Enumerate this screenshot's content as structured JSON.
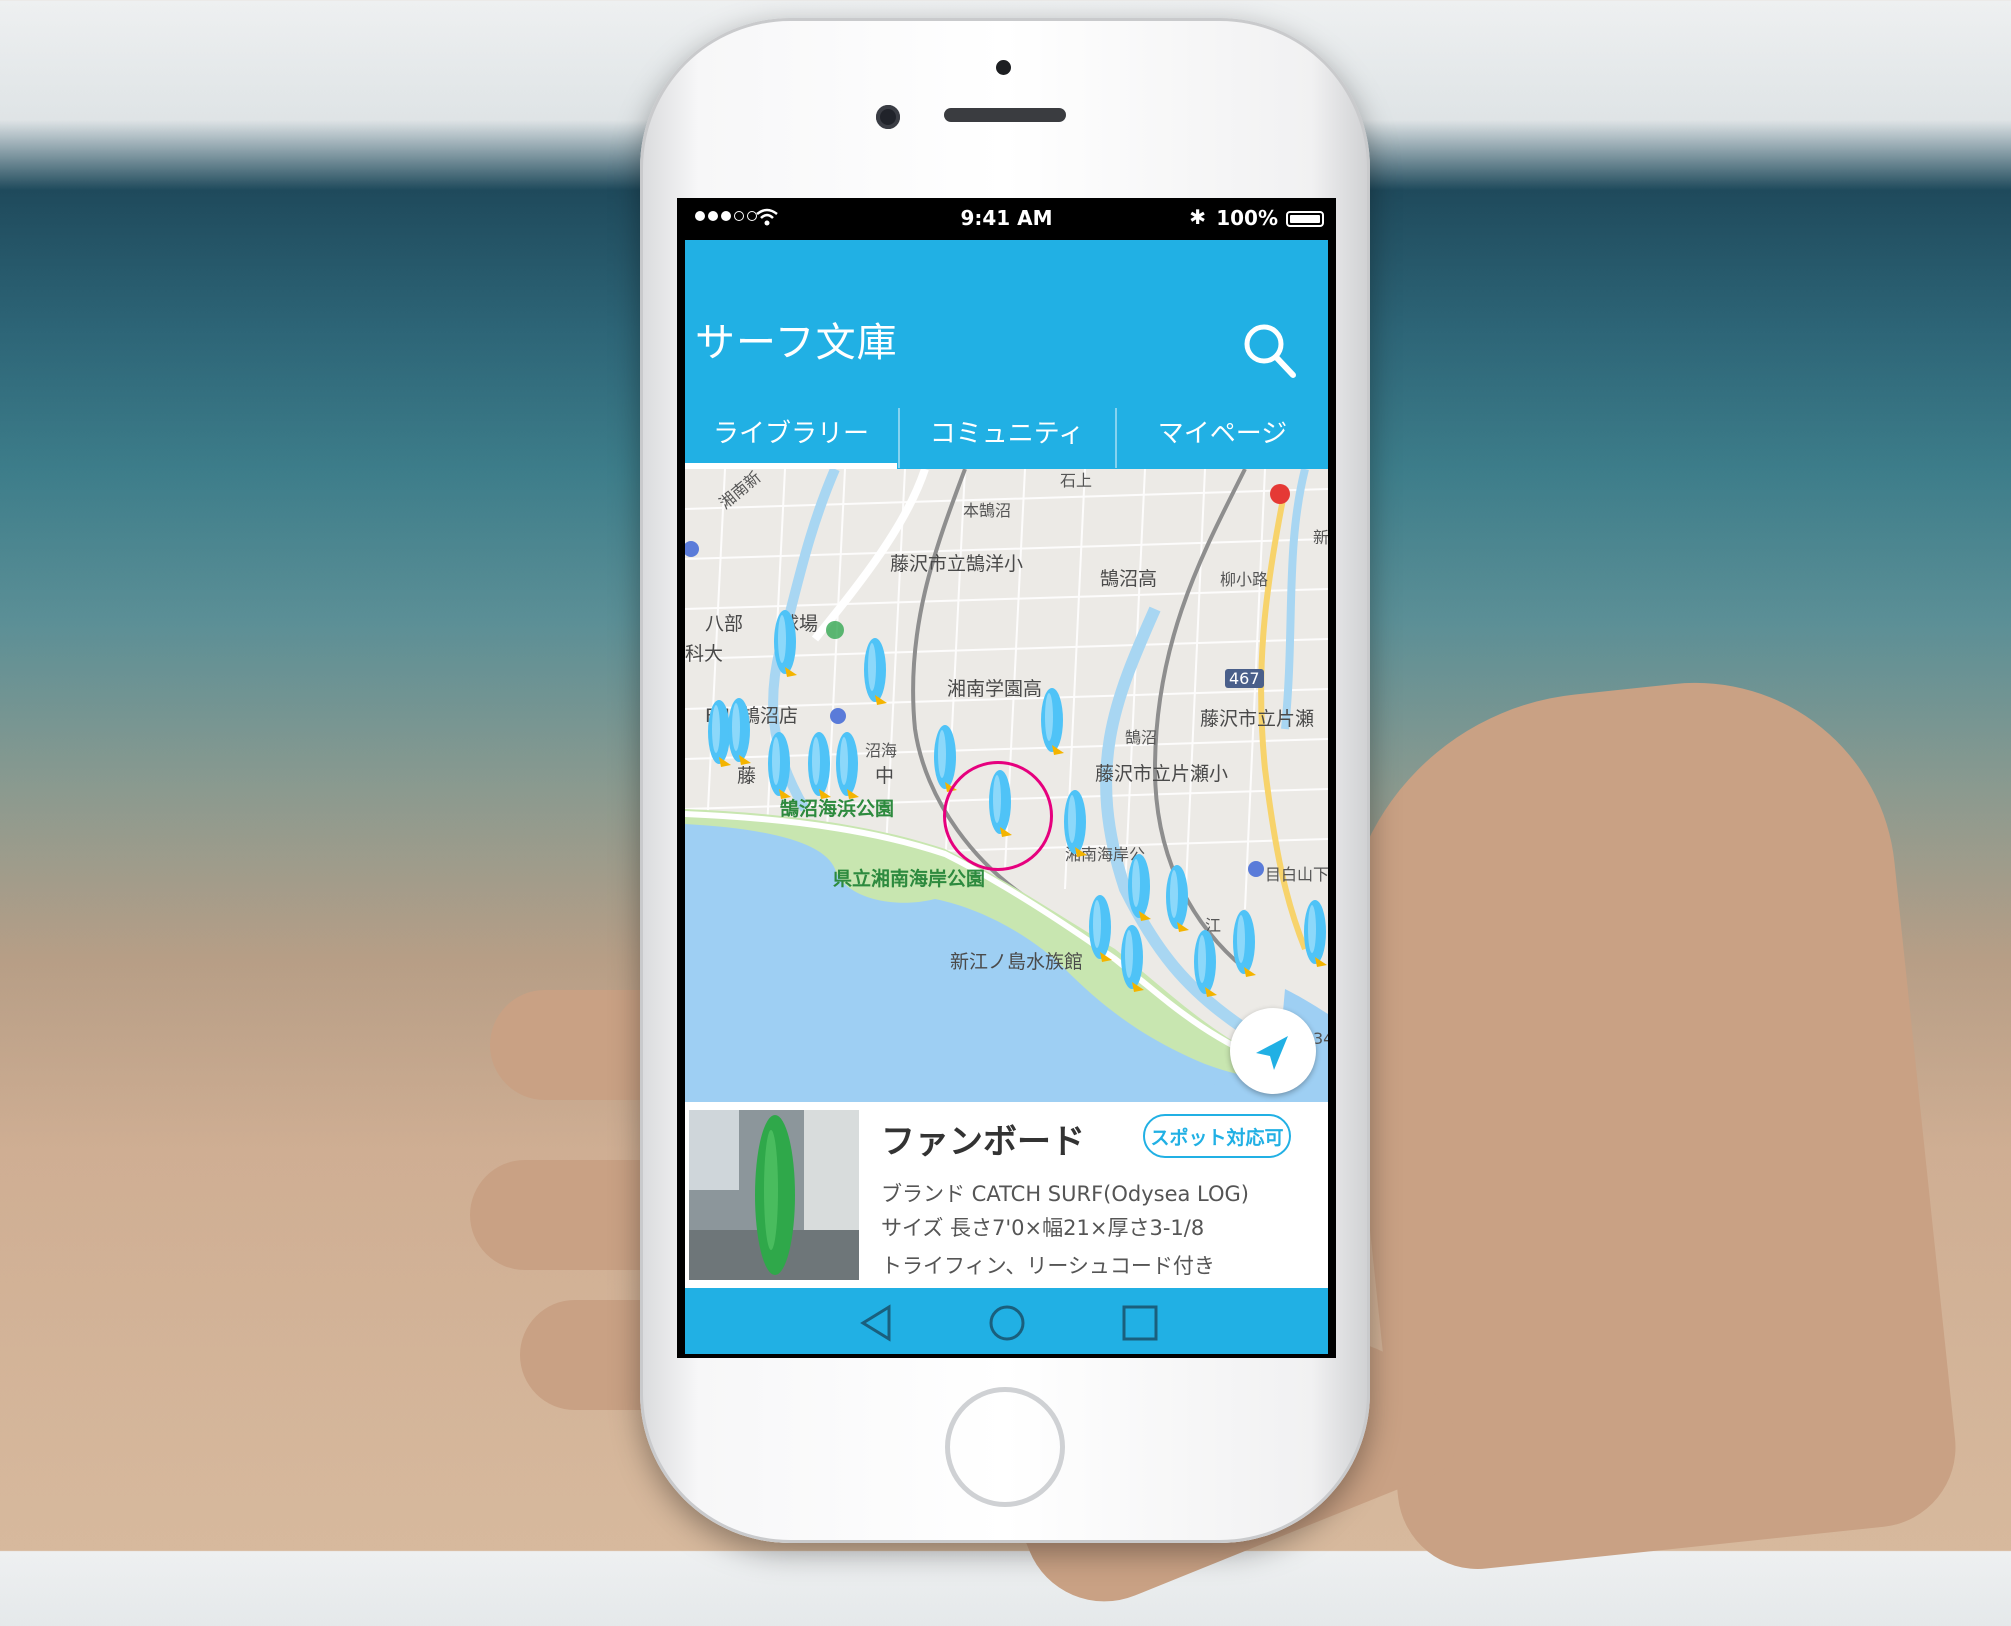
{
  "status_bar": {
    "time": "9:41 AM",
    "battery": "100%",
    "signal_icon": "signal-dots-icon",
    "wifi_icon": "wifi-icon",
    "bluetooth_icon": "bluetooth-icon",
    "battery_icon": "battery-icon"
  },
  "app": {
    "title": "サーフ文庫",
    "search_icon": "search-icon",
    "accent_color": "#21b0e4",
    "marker_color": "#4fc3f7",
    "highlight_color": "#e6007e"
  },
  "tabs": [
    {
      "label": "ライブラリー",
      "active": true
    },
    {
      "label": "コミュニティ",
      "active": false
    },
    {
      "label": "マイページ",
      "active": false
    }
  ],
  "map": {
    "labels": {
      "hon_kugenuma": "本鵠沼",
      "kugenuma_elementary": "藤沢市立鵠洋小",
      "kugenuma_high": "鵠沼高",
      "yanagikoji": "柳小路",
      "hachibu": "八部",
      "hachibu_park": "球場",
      "kadai": "科大",
      "shonan_gakuen": "湘南学園高",
      "fuji_store": "FUJI鵠沼店",
      "katase_city": "藤沢市立片瀬",
      "kugenuma_station": "鵠沼",
      "katase_elementary": "藤沢市立片瀬小",
      "fujisawa_fragment": "藤",
      "kugenuma_beach_park": "鵠沼海浜公園",
      "shonan_coast_park": "県立湘南海岸公園",
      "shonan_kaigan": "湘南海岸公",
      "enoshima_aquarium": "新江ノ島水族館",
      "mejiroyama": "目白山下",
      "ishigami": "石上",
      "route_467": "467",
      "shonan_top": "湘南新",
      "kugenuma_kaigan": "沼海",
      "junior_high_fragment": "中",
      "shin_fragment": "新",
      "route_134_fragment": "34",
      "e_fragment": "江"
    },
    "marker_icon": "surfboard-pin-icon",
    "locate_icon": "navigation-arrow-icon"
  },
  "card": {
    "name": "ファンボード",
    "badge": "スポット対応可",
    "brand": "ブランド  CATCH SURF(Odysea LOG)",
    "size": "サイズ 長さ7'0×幅21×厚さ3-1/8",
    "notes": "トライフィン、リーシュコード付き",
    "thumb_alt": "green-surfboard-photo"
  },
  "navbar": {
    "back_icon": "triangle-back-icon",
    "home_icon": "circle-home-icon",
    "recent_icon": "square-recent-icon"
  }
}
